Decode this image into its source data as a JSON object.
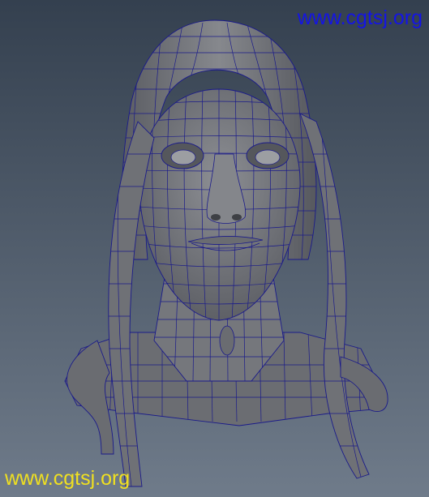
{
  "viewport": {
    "background": [
      "#34404f",
      "#6f7b8a"
    ],
    "mesh_fill": "#7d7f84",
    "wire_color": "#1a1a8a"
  },
  "watermarks": {
    "top": {
      "text": "www.cgtsj.org",
      "color": "#1414e6"
    },
    "bottom": {
      "text": "www.cgtsj.org",
      "color": "#f0e020"
    }
  }
}
